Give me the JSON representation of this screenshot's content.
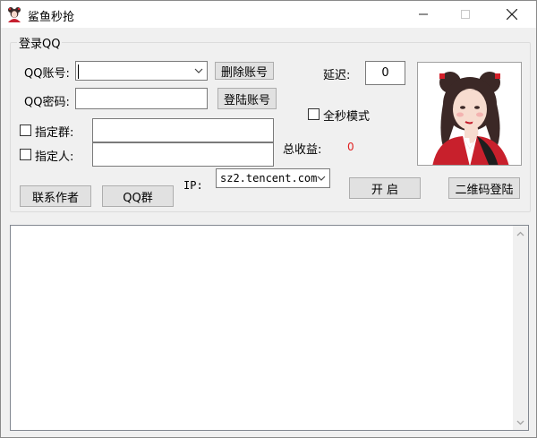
{
  "window": {
    "title": "鲨鱼秒抢",
    "icon": "girl-avatar-icon"
  },
  "group": {
    "legend": "登录QQ"
  },
  "login": {
    "account_label": "QQ账号:",
    "account_value": "",
    "password_label": "QQ密码:",
    "password_value": "",
    "delete_account_button": "删除账号",
    "login_account_button": "登陆账号"
  },
  "targets": {
    "group_label": "指定群:",
    "group_checked": false,
    "group_value": "",
    "person_label": "指定人:",
    "person_checked": false,
    "person_value": ""
  },
  "settings": {
    "delay_label": "延迟:",
    "delay_value": "0",
    "full_second_label": "全秒模式",
    "full_second_checked": false,
    "total_income_label": "总收益:",
    "total_income_value": "0",
    "ip_label": "IP:",
    "ip_value": "sz2.tencent.com"
  },
  "buttons": {
    "contact_author": "联系作者",
    "qq_group": "QQ群",
    "start": "开 启",
    "qrcode_login": "二维码登陆"
  },
  "colors": {
    "income": "#e02020",
    "window_bg": "#f0f0f0",
    "portrait_red": "#d4202a"
  },
  "log": {
    "text": ""
  }
}
